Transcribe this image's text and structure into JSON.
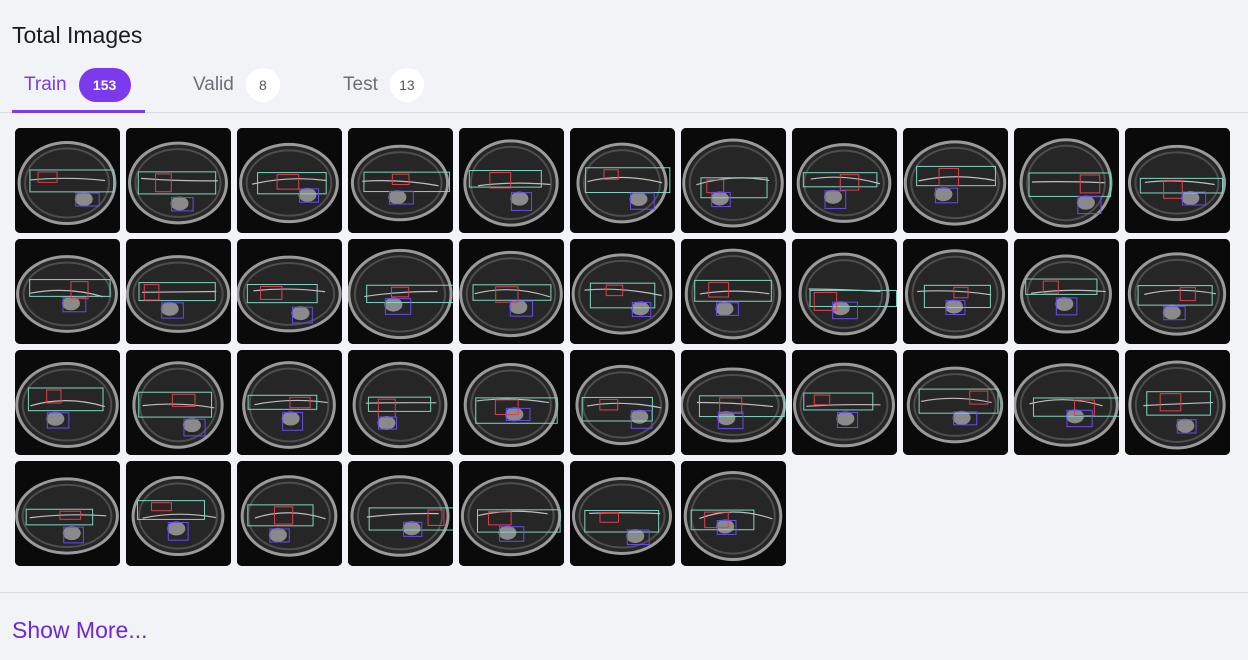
{
  "header": {
    "title": "Total Images"
  },
  "tabs": [
    {
      "label": "Train",
      "count": "153",
      "active": true
    },
    {
      "label": "Valid",
      "count": "8",
      "active": false
    },
    {
      "label": "Test",
      "count": "13",
      "active": false
    }
  ],
  "gallery": {
    "image_count": 40,
    "annotation_colors": {
      "region": "#7fd6c2",
      "marker": "#e0404f",
      "head": "#6a4de8"
    }
  },
  "footer": {
    "show_more_label": "Show More..."
  },
  "colors": {
    "accent": "#7c3aed",
    "link": "#6d28d9",
    "background": "#f2f3f6"
  }
}
